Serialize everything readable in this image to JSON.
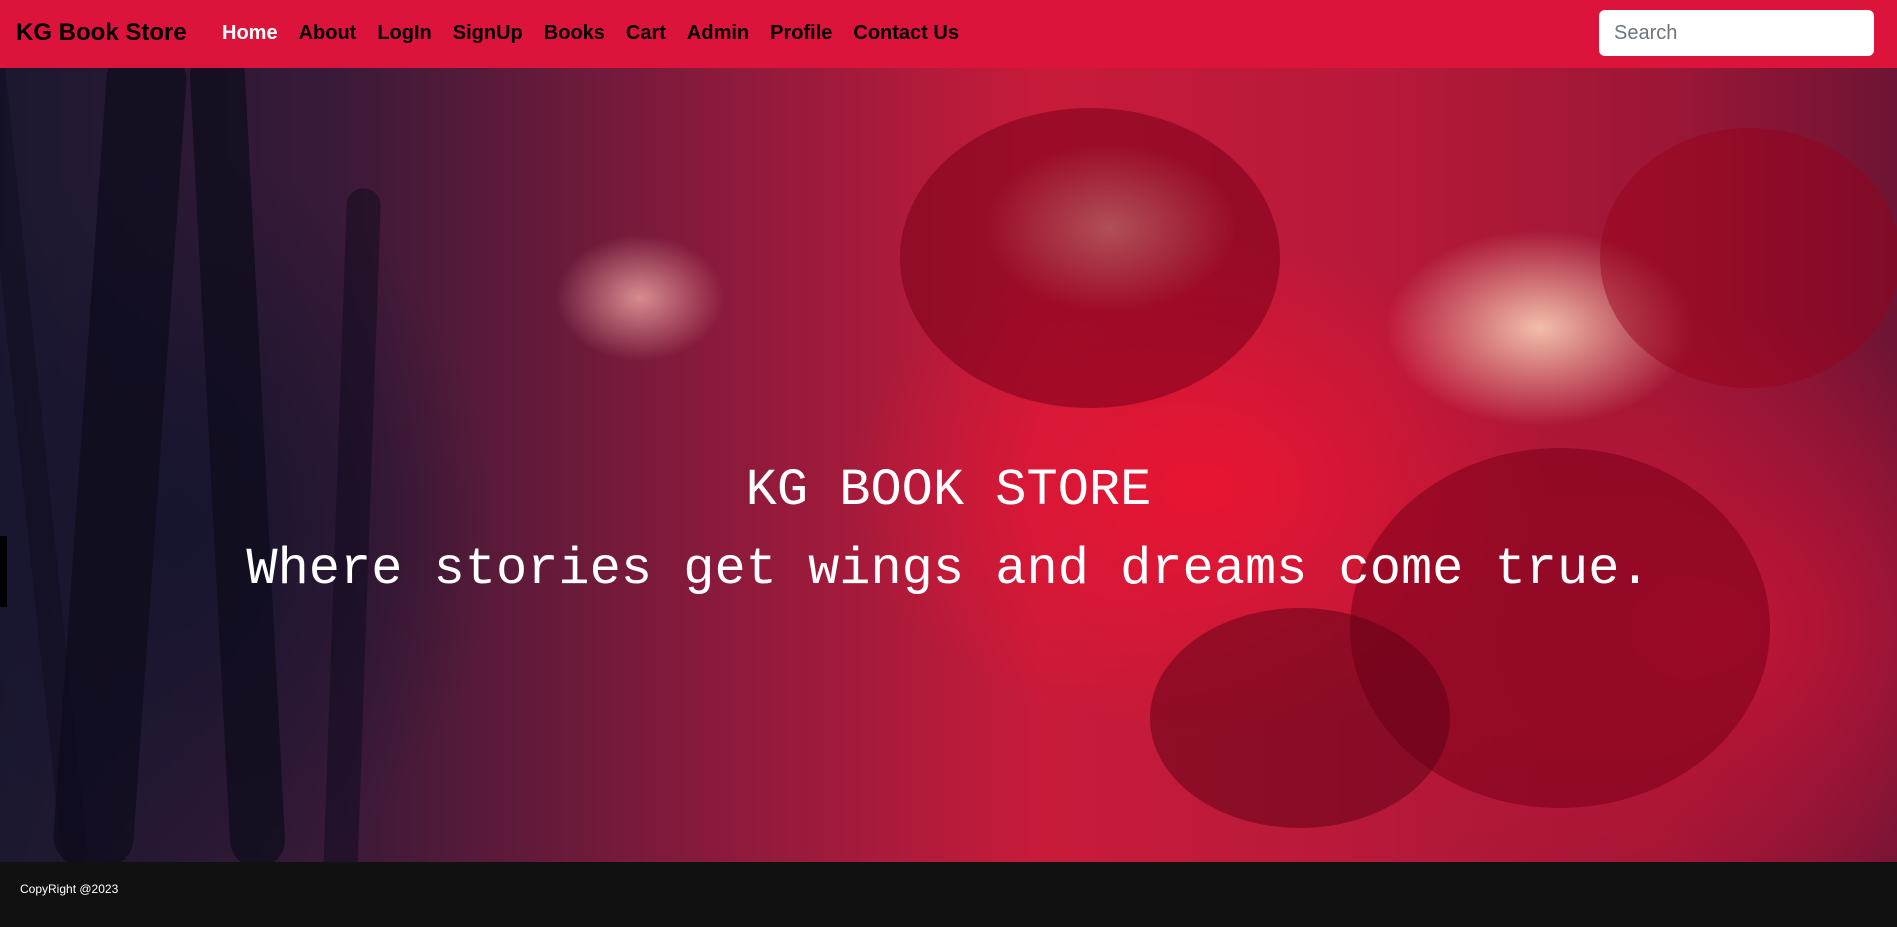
{
  "navbar": {
    "brand": "KG Book Store",
    "links": [
      {
        "label": "Home",
        "active": true
      },
      {
        "label": "About"
      },
      {
        "label": "LogIn"
      },
      {
        "label": "SignUp"
      },
      {
        "label": "Books"
      },
      {
        "label": "Cart"
      },
      {
        "label": "Admin"
      },
      {
        "label": "Profile"
      },
      {
        "label": "Contact Us"
      }
    ],
    "search_placeholder": "Search",
    "background_color": "#dc143c"
  },
  "hero": {
    "title": "KG BOOK STORE",
    "subtitle": "Where stories get wings and dreams come true."
  },
  "footer": {
    "text": "CopyRight @2023",
    "background_color": "#111111"
  }
}
